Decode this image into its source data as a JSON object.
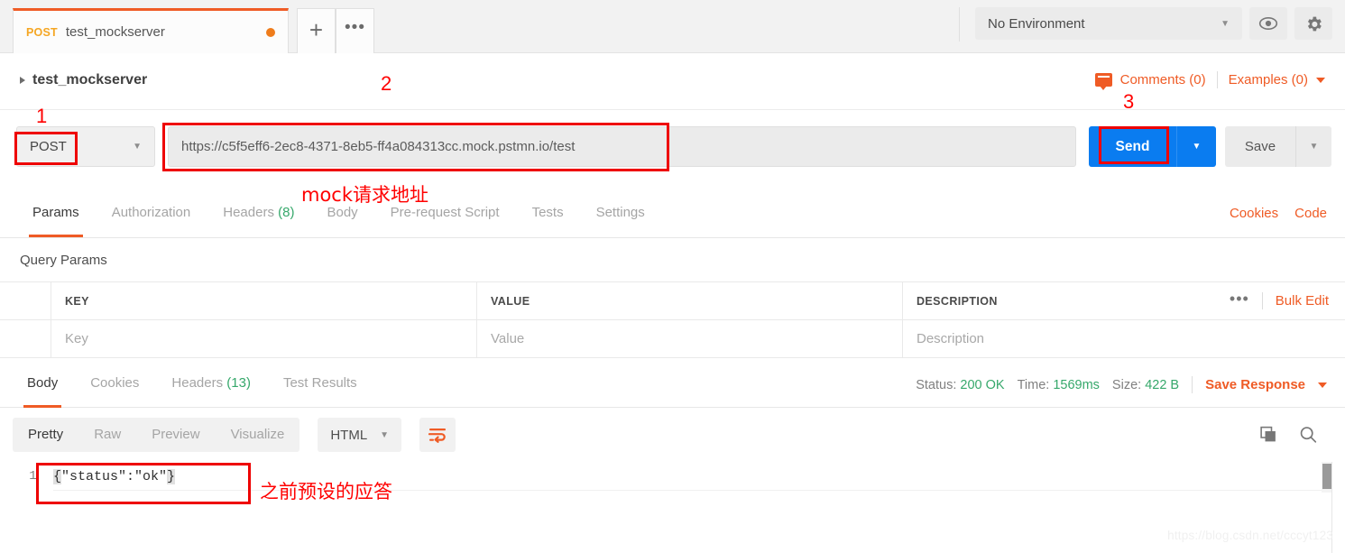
{
  "tabbar": {
    "tab": {
      "method": "POST",
      "title": "test_mockserver",
      "unsaved_dot": "●"
    },
    "new_tab_label": "+",
    "more_label": "•••",
    "environment": {
      "selected": "No Environment",
      "caret": "▼"
    },
    "eye_icon": "👁",
    "gear_icon": "⚙"
  },
  "breadcrumb": {
    "name": "test_mockserver",
    "comments_label": "Comments (0)",
    "examples_label": "Examples (0)"
  },
  "request": {
    "method": "POST",
    "method_caret": "▼",
    "url": "https://c5f5eff6-2ec8-4371-8eb5-ff4a084313cc.mock.pstmn.io/test",
    "send_label": "Send",
    "send_caret": "▼",
    "save_label": "Save",
    "save_caret": "▼"
  },
  "request_tabs": {
    "items": [
      {
        "label": "Params",
        "selected": true
      },
      {
        "label": "Authorization",
        "selected": false
      },
      {
        "label": "Headers",
        "count": "(8)",
        "selected": false
      },
      {
        "label": "Body",
        "selected": false
      },
      {
        "label": "Pre-request Script",
        "selected": false
      },
      {
        "label": "Tests",
        "selected": false
      },
      {
        "label": "Settings",
        "selected": false
      }
    ],
    "cookies_label": "Cookies",
    "code_label": "Code"
  },
  "query_params": {
    "title": "Query Params",
    "headers": {
      "key": "KEY",
      "value": "VALUE",
      "description": "DESCRIPTION"
    },
    "placeholders": {
      "key": "Key",
      "value": "Value",
      "description": "Description"
    },
    "more_label": "•••",
    "bulk_edit_label": "Bulk Edit"
  },
  "response": {
    "tabs": [
      {
        "label": "Body",
        "selected": true
      },
      {
        "label": "Cookies",
        "selected": false
      },
      {
        "label": "Headers",
        "count": "(13)",
        "selected": false
      },
      {
        "label": "Test Results",
        "selected": false
      }
    ],
    "status_label": "Status:",
    "status_value": "200 OK",
    "time_label": "Time:",
    "time_value": "1569ms",
    "size_label": "Size:",
    "size_value": "422 B",
    "save_response_label": "Save Response",
    "save_response_caret": "▼",
    "viewer": {
      "modes": [
        {
          "label": "Pretty",
          "selected": true
        },
        {
          "label": "Raw",
          "selected": false
        },
        {
          "label": "Preview",
          "selected": false
        },
        {
          "label": "Visualize",
          "selected": false
        }
      ],
      "format": "HTML",
      "format_caret": "▼",
      "wrap_icon": "wrap-lines-icon",
      "copy_icon": "copy-icon",
      "search_icon": "search-icon"
    },
    "body": {
      "line_number": "1",
      "open_brace": "{",
      "content": "\"status\":\"ok\"",
      "close_brace": "}"
    }
  },
  "annotations": {
    "n1": "1",
    "n2": "2",
    "n3": "3",
    "url_caption": "mock请求地址",
    "body_caption": "之前预设的应答"
  },
  "watermark": "https://blog.csdn.net/cccyt123",
  "colors": {
    "accent_orange": "#ef5b25",
    "send_blue": "#0a7cf0",
    "success_green": "#36a86b",
    "method_post": "#f5a623",
    "annotation_red": "#ff0000"
  }
}
